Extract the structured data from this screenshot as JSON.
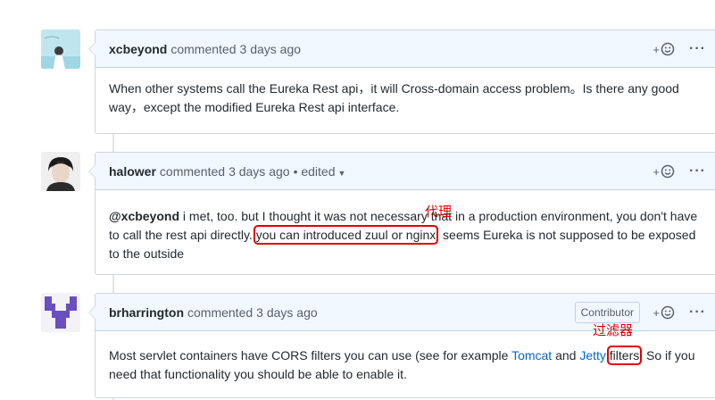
{
  "comments": [
    {
      "author": "xcbeyond",
      "verb": "commented",
      "time": "3 days ago",
      "body": "When other systems call the Eureka Rest api，it will Cross-domain access problem。Is there any good way，except the modified Eureka Rest api interface."
    },
    {
      "author": "halower",
      "verb": "commented",
      "time": "3 days ago",
      "edited": "• edited",
      "body_mention": "@xcbeyond",
      "body_part1": " i met, too. but I thought it was not necessary that in a production environment, you don't have to call the rest api directly. ",
      "body_highlight": "you can introduced zuul or nginx",
      "body_part2": ", seems Eureka is not supposed to be exposed to the outside"
    },
    {
      "author": "brharrington",
      "verb": "commented",
      "time": "3 days ago",
      "badge": "Contributor",
      "body_part1": "Most servlet containers have CORS filters you can use (see for example ",
      "link1": "Tomcat",
      "and": " and ",
      "link2": "Jetty",
      "body_highlight": "filters",
      "body_part2": ". So if you need that functionality you should be able to enable it."
    }
  ],
  "annotations": {
    "proxy": "代理",
    "filter": "过滤器"
  },
  "actions": {
    "reaction_plus": "+",
    "more": "···"
  },
  "icons": {
    "reaction": "smiley-icon",
    "more": "kebab-horizontal-icon",
    "caret": "triangle-down-icon"
  },
  "colors": {
    "header_bg": "#f1f8ff",
    "link": "#0366d6",
    "annotation": "#e00000"
  }
}
